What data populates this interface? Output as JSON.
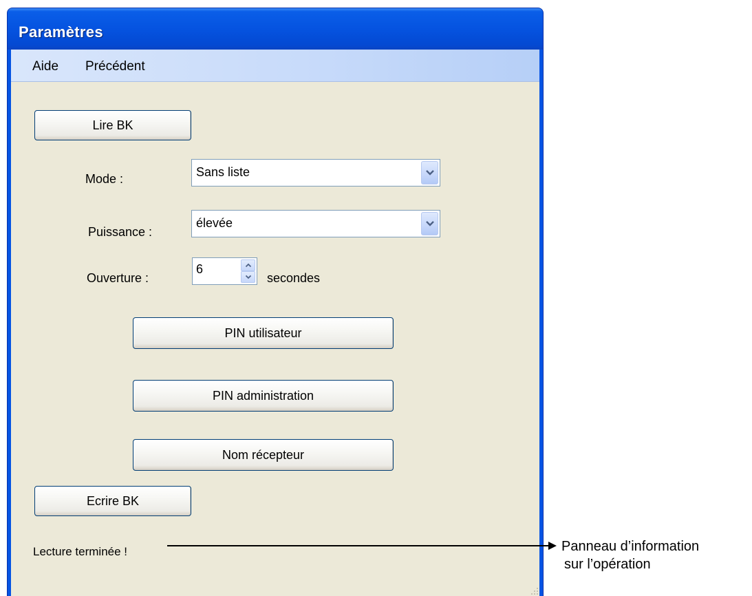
{
  "window": {
    "title": "Paramètres"
  },
  "menu": {
    "items": [
      "Aide",
      "Précédent"
    ]
  },
  "buttons": {
    "read": "Lire BK",
    "write": "Ecrire BK",
    "pin_user": "PIN utilisateur",
    "pin_admin": "PIN administration",
    "receiver_name": "Nom récepteur"
  },
  "fields": {
    "mode": {
      "label": "Mode :",
      "value": "Sans liste"
    },
    "power": {
      "label": "Puissance :",
      "value": "élevée"
    },
    "opening": {
      "label": "Ouverture :",
      "value": "6",
      "unit": "secondes"
    }
  },
  "status": {
    "message": "Lecture terminée !"
  },
  "annotation": {
    "line1": "Panneau d’information",
    "line2": "sur l’opération"
  },
  "colors": {
    "title_bar": "#0553e0",
    "client_bg": "#ece9d8",
    "menu_bg": "#c8dbfa",
    "button_border": "#003c74"
  }
}
